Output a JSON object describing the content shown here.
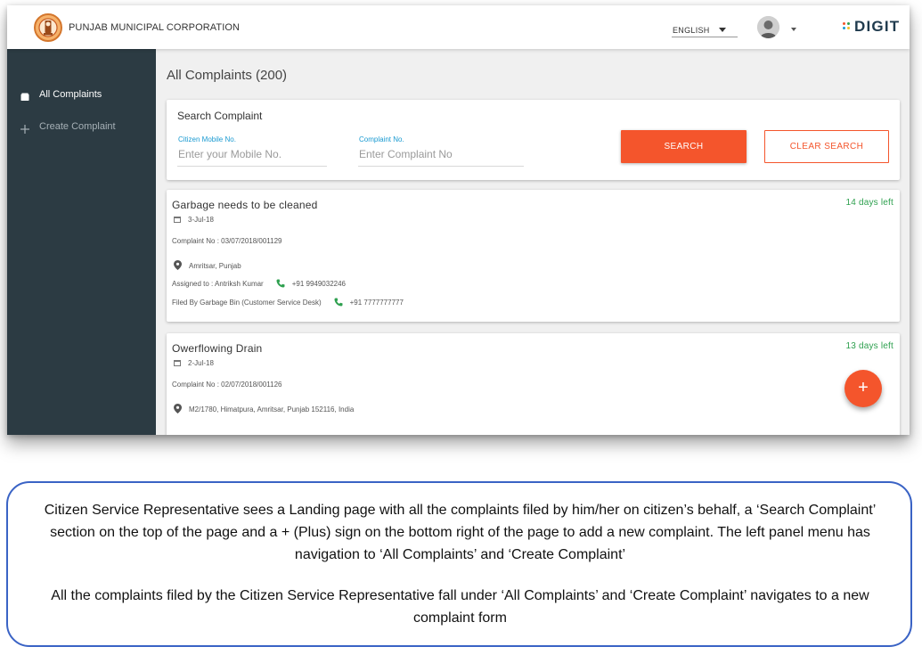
{
  "header": {
    "org_name": "PUNJAB MUNICIPAL CORPORATION",
    "language": "ENGLISH",
    "brand": "DIGIT",
    "brand_dot_colors": [
      "#f4552c",
      "#2ea04f",
      "#1a9ad1",
      "#f4c025"
    ]
  },
  "sidebar": {
    "items": [
      {
        "label": "All Complaints",
        "icon": "inbox-icon",
        "active": true
      },
      {
        "label": "Create Complaint",
        "icon": "plus-icon",
        "active": false
      }
    ]
  },
  "main": {
    "title": "All Complaints (200)"
  },
  "search": {
    "title": "Search Complaint",
    "mobile_label": "Citizen Mobile No.",
    "mobile_placeholder": "Enter your Mobile No.",
    "complaint_label": "Complaint No.",
    "complaint_placeholder": "Enter Complaint No",
    "search_button": "SEARCH",
    "clear_button": "CLEAR SEARCH"
  },
  "complaints": [
    {
      "title": "Garbage needs to be cleaned",
      "date": "3-Jul-18",
      "days_left": "14 days left",
      "complaint_no": "Complaint No : 03/07/2018/001129",
      "location": "Amritsar, Punjab",
      "assigned_to": "Assigned to : Antriksh Kumar",
      "assigned_phone": "+91 9949032246",
      "filed_by": "Filed By Garbage Bin (Customer Service Desk)",
      "filed_phone": "+91 7777777777"
    },
    {
      "title": "Owerflowing Drain",
      "date": "2-Jul-18",
      "days_left": "13 days left",
      "complaint_no": "Complaint No : 02/07/2018/001126",
      "location": "M2/1780, Himatpura, Amritsar, Punjab 152116, India"
    }
  ],
  "fab": {
    "label": "+"
  },
  "colors": {
    "accent": "#f4552c",
    "sidebar_bg": "#2c3b43",
    "days_left": "#2ea04f",
    "field_label": "#1a9ad1",
    "description_border": "#3a63c5"
  },
  "description": {
    "paragraph1": "Citizen Service Representative sees a Landing page with all the complaints filed by him/her on citizen’s behalf, a ‘Search Complaint’ section on the top of the page and a + (Plus) sign on the bottom right of the page to add a new complaint. The left panel menu has navigation to ‘All Complaints’ and ‘Create Complaint’",
    "paragraph2": "All the complaints filed by the Citizen Service Representative fall under ‘All Complaints’ and ‘Create Complaint’ navigates to a new complaint form"
  }
}
